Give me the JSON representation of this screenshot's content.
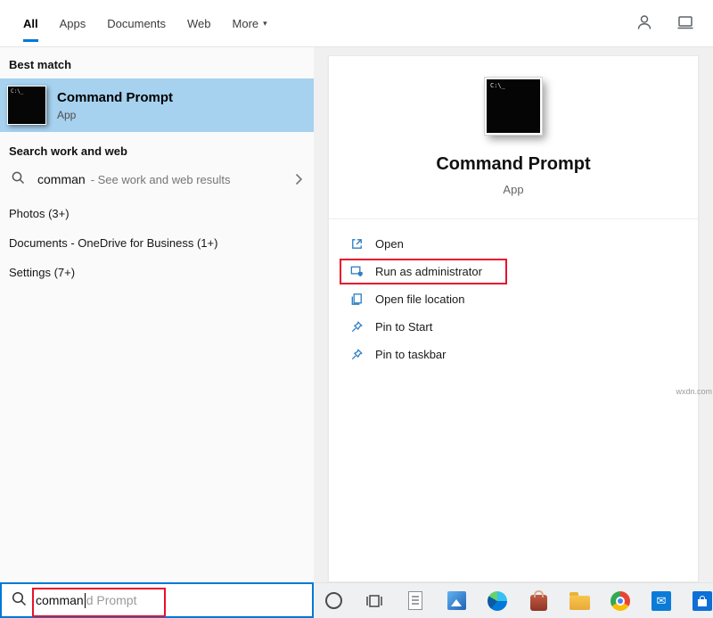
{
  "colors": {
    "accent_blue": "#0078d7",
    "best_match_highlight": "#a6d1ef",
    "annotation_red": "#e8112d",
    "action_icon_blue": "#2e7ec2"
  },
  "search_tabs": {
    "items": [
      {
        "label": "All",
        "active": true
      },
      {
        "label": "Apps",
        "active": false
      },
      {
        "label": "Documents",
        "active": false
      },
      {
        "label": "Web",
        "active": false
      },
      {
        "label": "More",
        "active": false,
        "has_dropdown": true
      }
    ]
  },
  "app_icon": {
    "glyph": "C:\\_"
  },
  "left_panel": {
    "best_match_header": "Best match",
    "best_match": {
      "title": "Command Prompt",
      "subtitle": "App"
    },
    "search_web_header": "Search work and web",
    "web_suggestion": {
      "query": "comman",
      "hint": "- See work and web results"
    },
    "categories": [
      "Photos (3+)",
      "Documents - OneDrive for Business (1+)",
      "Settings (7+)"
    ]
  },
  "preview_panel": {
    "title": "Command Prompt",
    "subtitle": "App",
    "actions": [
      {
        "label": "Open",
        "icon": "open-icon",
        "annotated": false
      },
      {
        "label": "Run as administrator",
        "icon": "run-as-admin-icon",
        "annotated": true
      },
      {
        "label": "Open file location",
        "icon": "open-file-location-icon",
        "annotated": false
      },
      {
        "label": "Pin to Start",
        "icon": "pin-icon",
        "annotated": false
      },
      {
        "label": "Pin to taskbar",
        "icon": "pin-icon",
        "annotated": false
      }
    ]
  },
  "search_box": {
    "typed": "comman",
    "autocomplete": "d Prompt"
  },
  "taskbar": {
    "icons": [
      "cortana-icon",
      "task-view-icon",
      "document-icon",
      "photos-icon",
      "edge-icon",
      "shopping-bag-icon",
      "file-explorer-icon",
      "chrome-icon",
      "mail-icon",
      "store-icon"
    ]
  },
  "watermark": "wxdn.com"
}
